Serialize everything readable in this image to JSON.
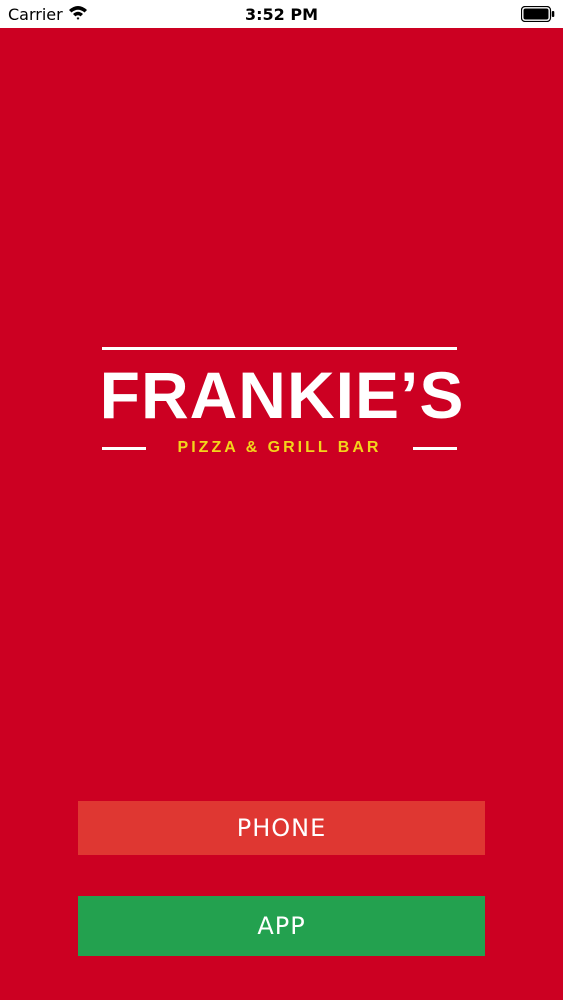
{
  "status_bar": {
    "carrier": "Carrier",
    "time": "3:52 PM",
    "wifi_icon": "wifi-icon",
    "battery_icon": "battery-icon"
  },
  "logo": {
    "name": "FRANKIE’S",
    "subtitle": "PIZZA & GRILL BAR"
  },
  "buttons": {
    "phone_label": "PHONE",
    "app_label": "APP"
  },
  "colors": {
    "background": "#cc0022",
    "phone_button": "#df3732",
    "app_button": "#23a14f",
    "subtitle": "#f2d51b"
  }
}
